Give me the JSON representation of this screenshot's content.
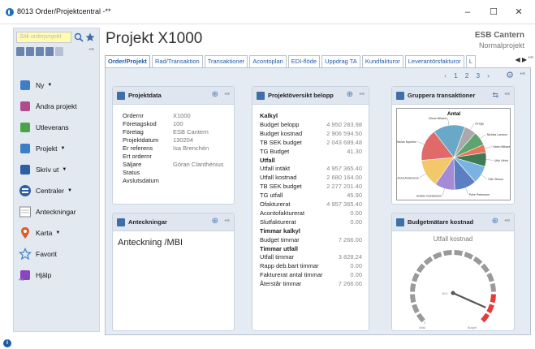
{
  "window": {
    "title": "8013 Order/Projektcentral -**",
    "minimize": "–",
    "maximize": "☐",
    "close": "✕"
  },
  "sidebar": {
    "search_placeholder": "Sök orderprojekt",
    "pin": "•≡",
    "items": [
      {
        "label": "Ny",
        "icon": "new-document-icon",
        "has_caret": true
      },
      {
        "label": "Ändra projekt",
        "icon": "edit-icon",
        "has_caret": false
      },
      {
        "label": "Utleverans",
        "icon": "delivery-icon",
        "has_caret": false
      },
      {
        "label": "Projekt",
        "icon": "project-icon",
        "has_caret": true
      },
      {
        "label": "Skriv ut",
        "icon": "printer-icon",
        "has_caret": true
      },
      {
        "label": "Centraler",
        "icon": "centrals-icon",
        "has_caret": true
      },
      {
        "label": "Anteckningar",
        "icon": "notes-icon",
        "has_caret": false
      },
      {
        "label": "Karta",
        "icon": "map-pin-icon",
        "has_caret": true
      },
      {
        "label": "Favorit",
        "icon": "star-icon",
        "has_caret": false
      },
      {
        "label": "Hjälp",
        "icon": "help-icon",
        "has_caret": false
      }
    ],
    "caret": "▼",
    "collapse": "•≡"
  },
  "header": {
    "title": "Projekt X1000",
    "company": "ESB Cantern",
    "pricelist": "Normalprojekt"
  },
  "tabs": [
    {
      "label": "Order/Projekt",
      "active": true
    },
    {
      "label": "Rad/Transaktion",
      "active": false
    },
    {
      "label": "Transaktioner",
      "active": false
    },
    {
      "label": "Acontoplan",
      "active": false
    },
    {
      "label": "EDI-flöde",
      "active": false
    },
    {
      "label": "Uppdrag TA",
      "active": false
    },
    {
      "label": "Kundfakturor",
      "active": false
    },
    {
      "label": "Leverantörsfakturor",
      "active": false
    },
    {
      "label": "L",
      "active": false
    }
  ],
  "tab_arrows": "◀ ▶",
  "tab_pin": "•≡",
  "pager": {
    "prev": "‹",
    "pages": [
      "1",
      "2",
      "3"
    ],
    "next": "›",
    "pin": "•≡",
    "gear": "⚙"
  },
  "panel_pin": "•≡",
  "panel_zoom": "⊕",
  "projektdata": {
    "title": "Projektdata",
    "rows": [
      {
        "label": "Ordernr",
        "value": "X1000"
      },
      {
        "label": "Företagskod",
        "value": "100"
      },
      {
        "label": "Företag",
        "value": "ESB Cantern"
      },
      {
        "label": "Projektdatum",
        "value": "130204"
      },
      {
        "label": "Er referens",
        "value": "Isa Brenchén"
      },
      {
        "label": "Ert ordernr",
        "value": ""
      },
      {
        "label": "Säljare",
        "value": "Göran Clanthénius"
      },
      {
        "label": "Status",
        "value": ""
      },
      {
        "label": "Avslutsdatum",
        "value": ""
      }
    ]
  },
  "anteckningar": {
    "title": "Anteckningar",
    "text": "Anteckning /MBI"
  },
  "belopp": {
    "title": "Projektöversikt belopp",
    "rows": [
      {
        "label": "Kalkyl",
        "value": "",
        "bold": true
      },
      {
        "label": "Budget belopp",
        "value": "4 950 283.98",
        "bold": false
      },
      {
        "label": "Budget kostnad",
        "value": "2 906 594.50",
        "bold": false
      },
      {
        "label": "TB SEK budget",
        "value": "2 043 689.48",
        "bold": false
      },
      {
        "label": "TG Budget",
        "value": "41.30",
        "bold": false
      },
      {
        "label": "Utfall",
        "value": "",
        "bold": true
      },
      {
        "label": "Utfall intäkt",
        "value": "4 957 365.40",
        "bold": false
      },
      {
        "label": "Utfall kostnad",
        "value": "2 680 164.00",
        "bold": false
      },
      {
        "label": "TB SEK budget",
        "value": "2 277 201.40",
        "bold": false
      },
      {
        "label": "TG utfall",
        "value": "45.90",
        "bold": false
      },
      {
        "label": "Ofakturerat",
        "value": "4 957 365.40",
        "bold": false
      },
      {
        "label": "Acontofakturerat",
        "value": "0.00",
        "bold": false
      },
      {
        "label": "Slutfakturerat",
        "value": "0.00",
        "bold": false
      },
      {
        "label": "Timmar kalkyl",
        "value": "",
        "bold": true
      },
      {
        "label": "Budget timmar",
        "value": "7 266.00",
        "bold": false
      },
      {
        "label": "Timmar utfall",
        "value": "",
        "bold": true
      },
      {
        "label": "Utfall timmar",
        "value": "3 828.24",
        "bold": false
      },
      {
        "label": "Rapp deb.bart timmar",
        "value": "0.00",
        "bold": false
      },
      {
        "label": "Fakturerat antal timmar",
        "value": "0.00",
        "bold": false
      },
      {
        "label": "Återstår timmar",
        "value": "7 266.00",
        "bold": false
      }
    ]
  },
  "gruppera": {
    "title": "Gruppera transaktioner",
    "swap": "⇆",
    "chart_data": {
      "type": "pie",
      "title": "Antal",
      "slices": [
        {
          "label": "Övriga",
          "value": 6,
          "color": "#a9a9a9"
        },
        {
          "label": "Nicklas Larsson",
          "value": 7,
          "color": "#5fa46f"
        },
        {
          "label": "Hans Håkansson",
          "value": 4,
          "color": "#e8735e"
        },
        {
          "label": "Ulrik Ulrich",
          "value": 7,
          "color": "#3e7a52"
        },
        {
          "label": "Olle Olsson",
          "value": 9,
          "color": "#7ab3e2"
        },
        {
          "label": "Pelle Petersson",
          "value": 11,
          "color": "#5c7ec2"
        },
        {
          "label": "Gustav Gustavsson",
          "value": 10,
          "color": "#a58bd6"
        },
        {
          "label": "Anna Andersson",
          "value": 14,
          "color": "#f3c86a"
        },
        {
          "label": "Niclas Nyström",
          "value": 16,
          "color": "#e06a6a"
        },
        {
          "label": "Göran Nilsson",
          "value": 16,
          "color": "#6aa8c8"
        }
      ]
    }
  },
  "budgetmatare": {
    "title": "Budgetmätare kostnad",
    "chart_data": {
      "type": "gauge",
      "title": "Utfall kostnad",
      "value": 2680164,
      "min": 0,
      "max": 2906595,
      "tick_mid": "50%",
      "min_label": "Utfall",
      "min_value": "2 906 594",
      "max_label": "Budget",
      "max_value": "2 906 595",
      "zero_label": "0"
    }
  },
  "footer": {
    "info_icon": "i"
  }
}
